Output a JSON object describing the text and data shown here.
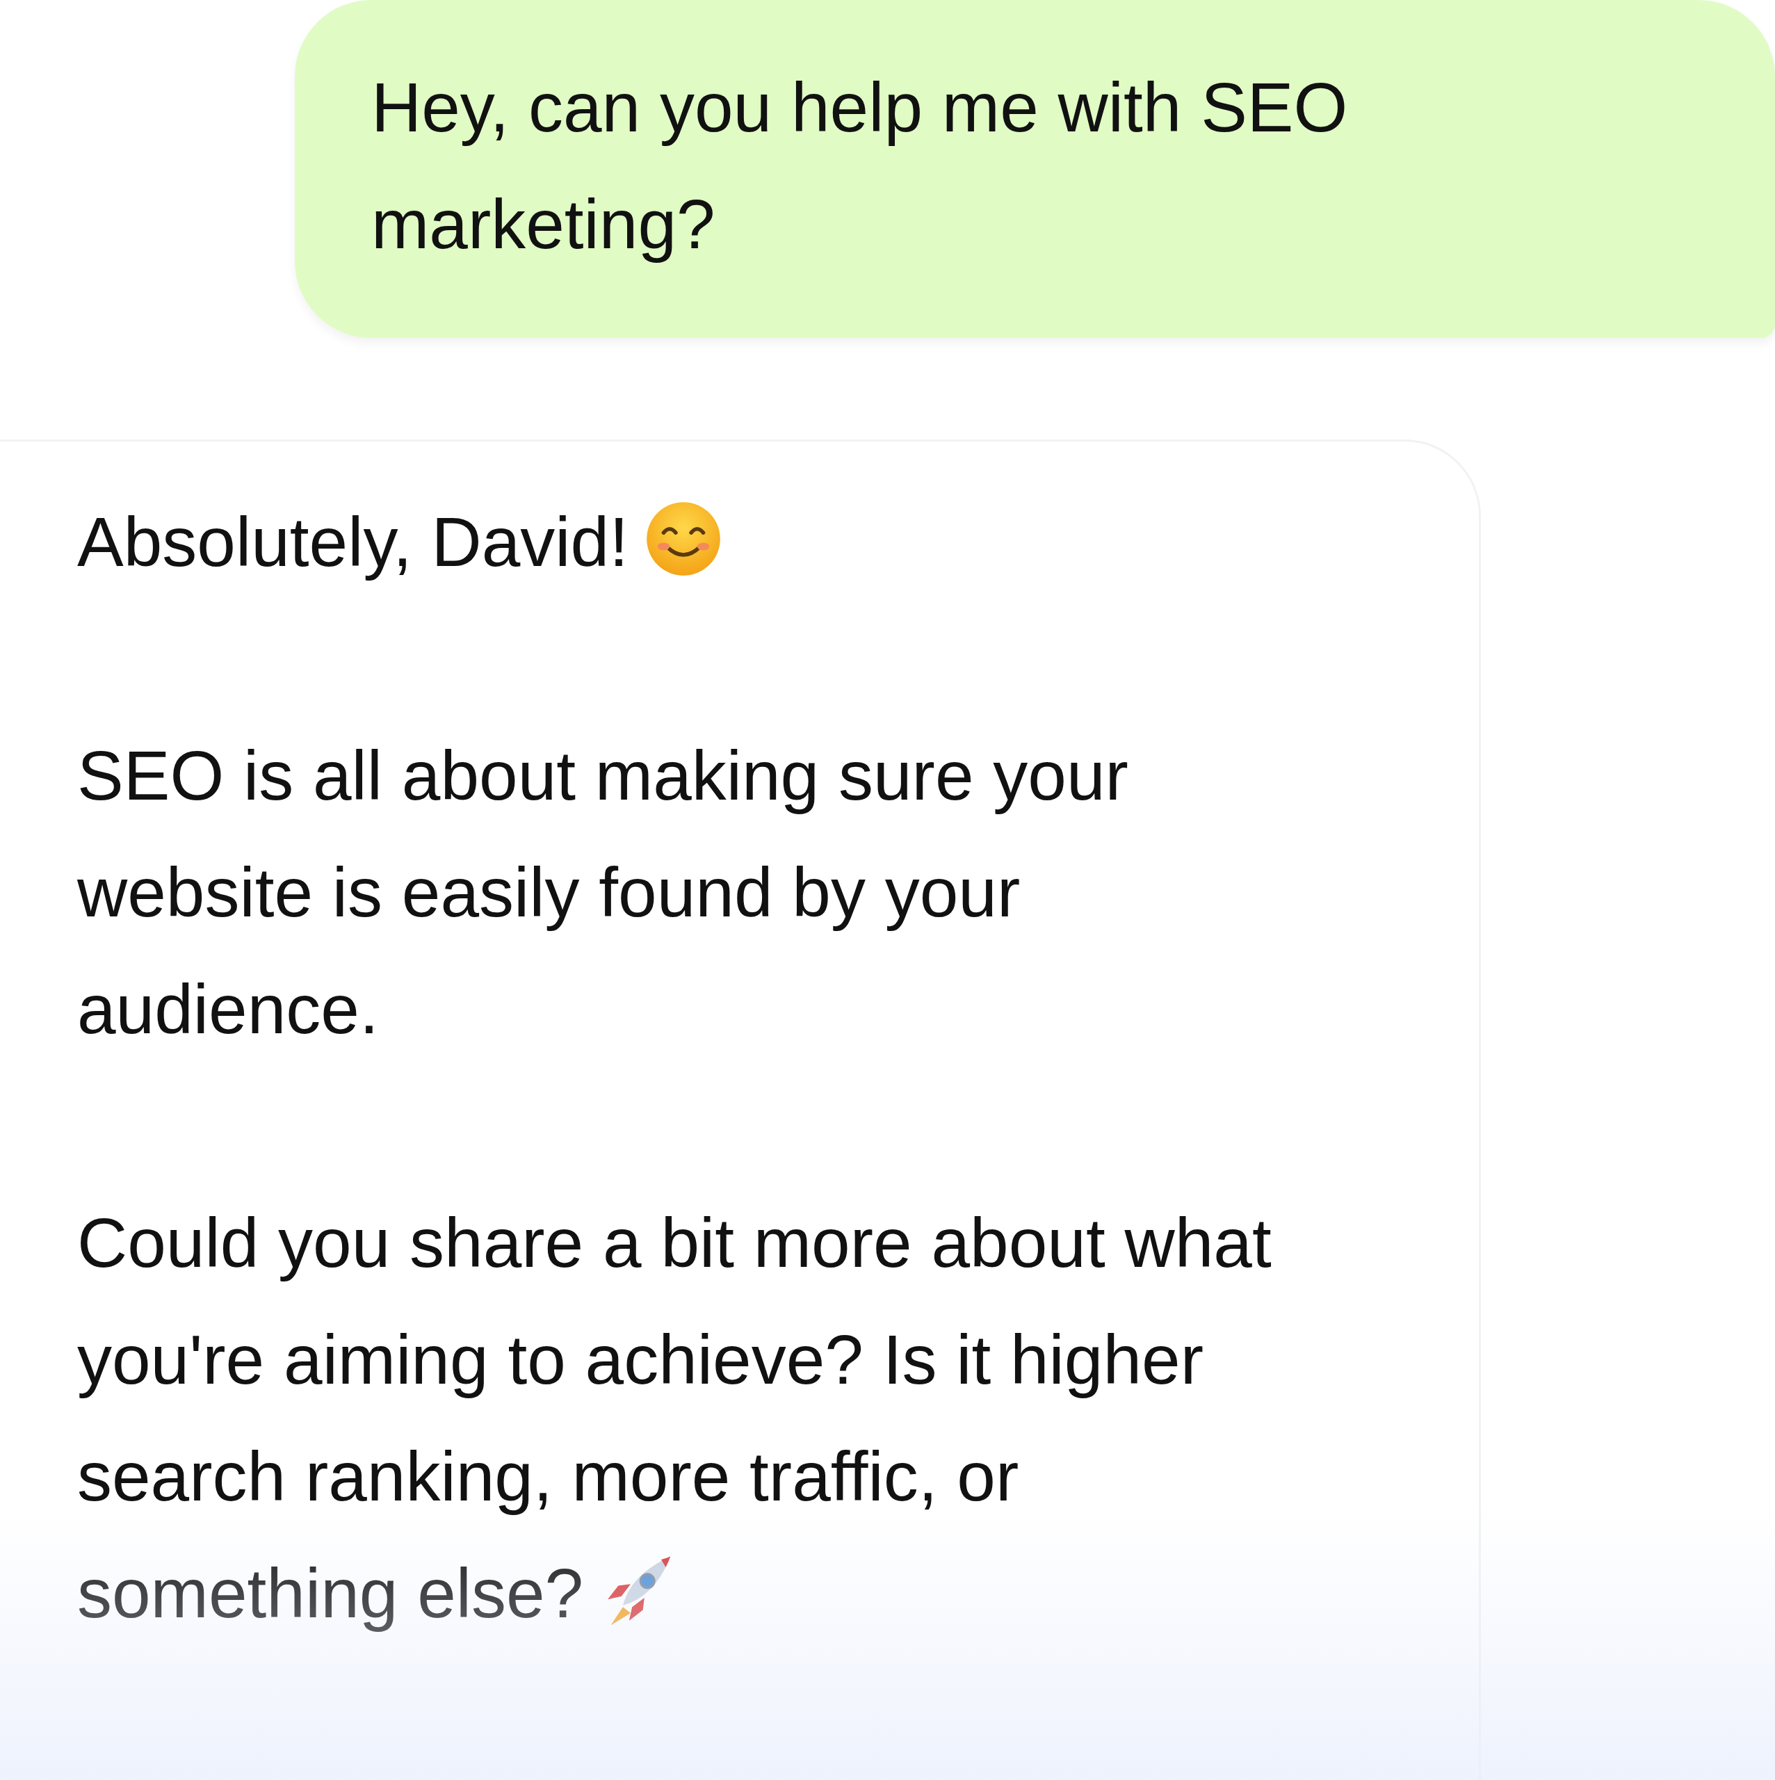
{
  "messages": [
    {
      "kind": "outgoing",
      "paragraphs": [
        {
          "text": "Hey, can you help me with SEO\nmarketing?"
        }
      ]
    },
    {
      "kind": "incoming",
      "paragraphs": [
        {
          "text": "Absolutely, David!",
          "kind": "smile"
        },
        {
          "text": "SEO is all about making sure your\nwebsite is easily found by your\naudience."
        },
        {
          "text": "Could you share a bit more about what\nyou're aiming to achieve? Is it higher\nsearch ranking, more traffic, or\nsomething else?",
          "kind": "rocket"
        }
      ]
    }
  ]
}
